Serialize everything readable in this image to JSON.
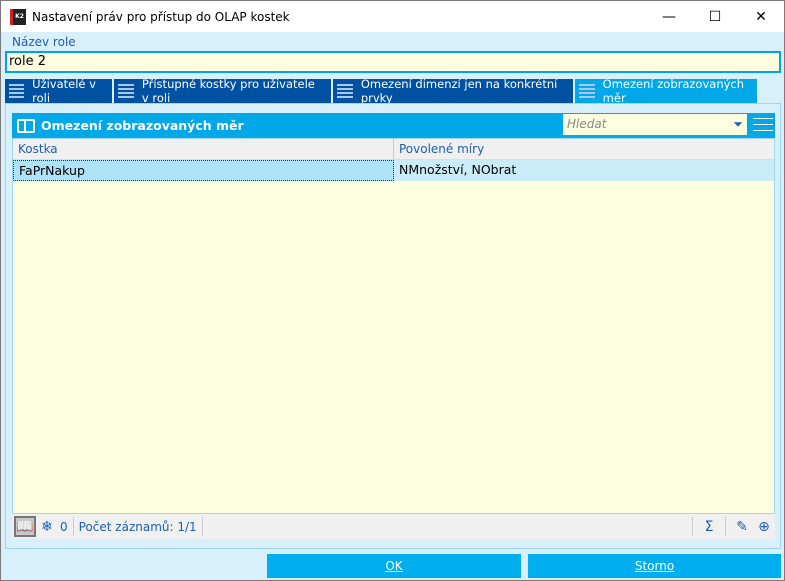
{
  "window": {
    "title": "Nastavení práv pro přístup do OLAP kostek",
    "logo_text": "K2"
  },
  "role": {
    "label": "Název role",
    "value": "role 2"
  },
  "tabs": [
    {
      "label": "Uživatelé v roli"
    },
    {
      "label": "Přístupné kostky pro uživatele v roli"
    },
    {
      "label": "Omezení dimenzí jen na konkrétní prvky"
    },
    {
      "label": "Omezení zobrazovaných měr"
    }
  ],
  "grid": {
    "title": "Omezení zobrazovaných měr",
    "search_placeholder": "Hledat",
    "columns": [
      "Kostka",
      "Povolené míry"
    ],
    "rows": [
      [
        "FaPrNakup",
        "NMnožství, NObrat"
      ]
    ]
  },
  "status": {
    "count": "0",
    "records": "Počet záznamů: 1/1"
  },
  "buttons": {
    "ok": "OK",
    "cancel": "Storno"
  }
}
